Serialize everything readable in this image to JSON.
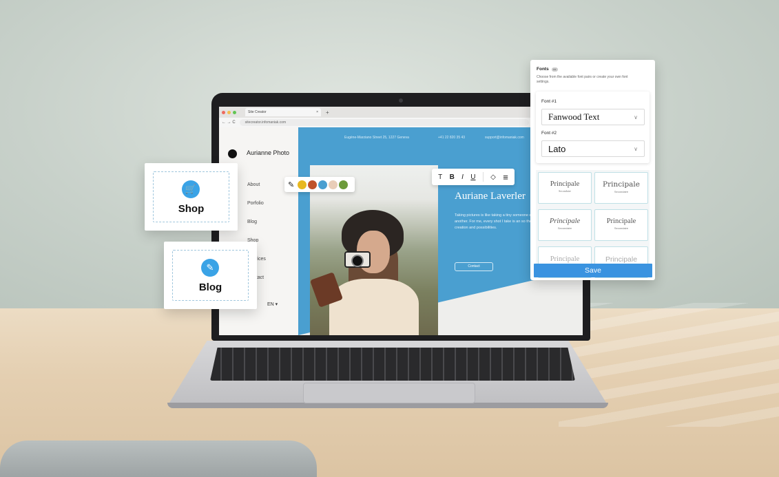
{
  "browser": {
    "tab_title": "Site Creator",
    "tab_close": "×",
    "new_tab": "+",
    "url": "sitecreator.infomaniak.com",
    "nav_glyphs": "← → C"
  },
  "site": {
    "brand": "Aurianne Photo",
    "menu": [
      "About",
      "Porfolio",
      "Blog",
      "Shop",
      "Services",
      "Contact"
    ],
    "language": "EN",
    "address": "Eugène-Marziano Street 25, 1227 Geneva",
    "phone": "+41 22 820 35 43",
    "email": "support@infomaniak.com",
    "hero_title": "Auriane Laverler",
    "hero_text": "Taking pictures is like taking a tiny someone else's eyes of another. For me, every shot I take is an so the wonders of creation and possibilities.",
    "contact_label": "Contact"
  },
  "color_toolbar": {
    "icon": "pencil-icon",
    "swatches": [
      "#e8b81f",
      "#c0532a",
      "#4a9fd0",
      "#e9cdb8",
      "#6c9a3a"
    ]
  },
  "text_toolbar": {
    "items": [
      "T",
      "B",
      "I",
      "U",
      "◇",
      "≡"
    ]
  },
  "cards": {
    "shop_label": "Shop",
    "blog_label": "Blog"
  },
  "fonts_panel": {
    "title": "Fonts",
    "description": "Choose from the available font pairs or create your own font settings.",
    "font1_label": "Font #1",
    "font1_value": "Fanwood Text",
    "font2_label": "Font #2",
    "font2_value": "Lato",
    "pairs": [
      {
        "main": "Principale",
        "sub": "Secondaire"
      },
      {
        "main": "Principale",
        "sub": "Secondaire"
      },
      {
        "main": "Principale",
        "sub": "Secondaire"
      },
      {
        "main": "Principale",
        "sub": "Secondaire"
      },
      {
        "main": "Principale",
        "sub": ""
      },
      {
        "main": "Principale",
        "sub": ""
      }
    ],
    "save_label": "Save"
  }
}
